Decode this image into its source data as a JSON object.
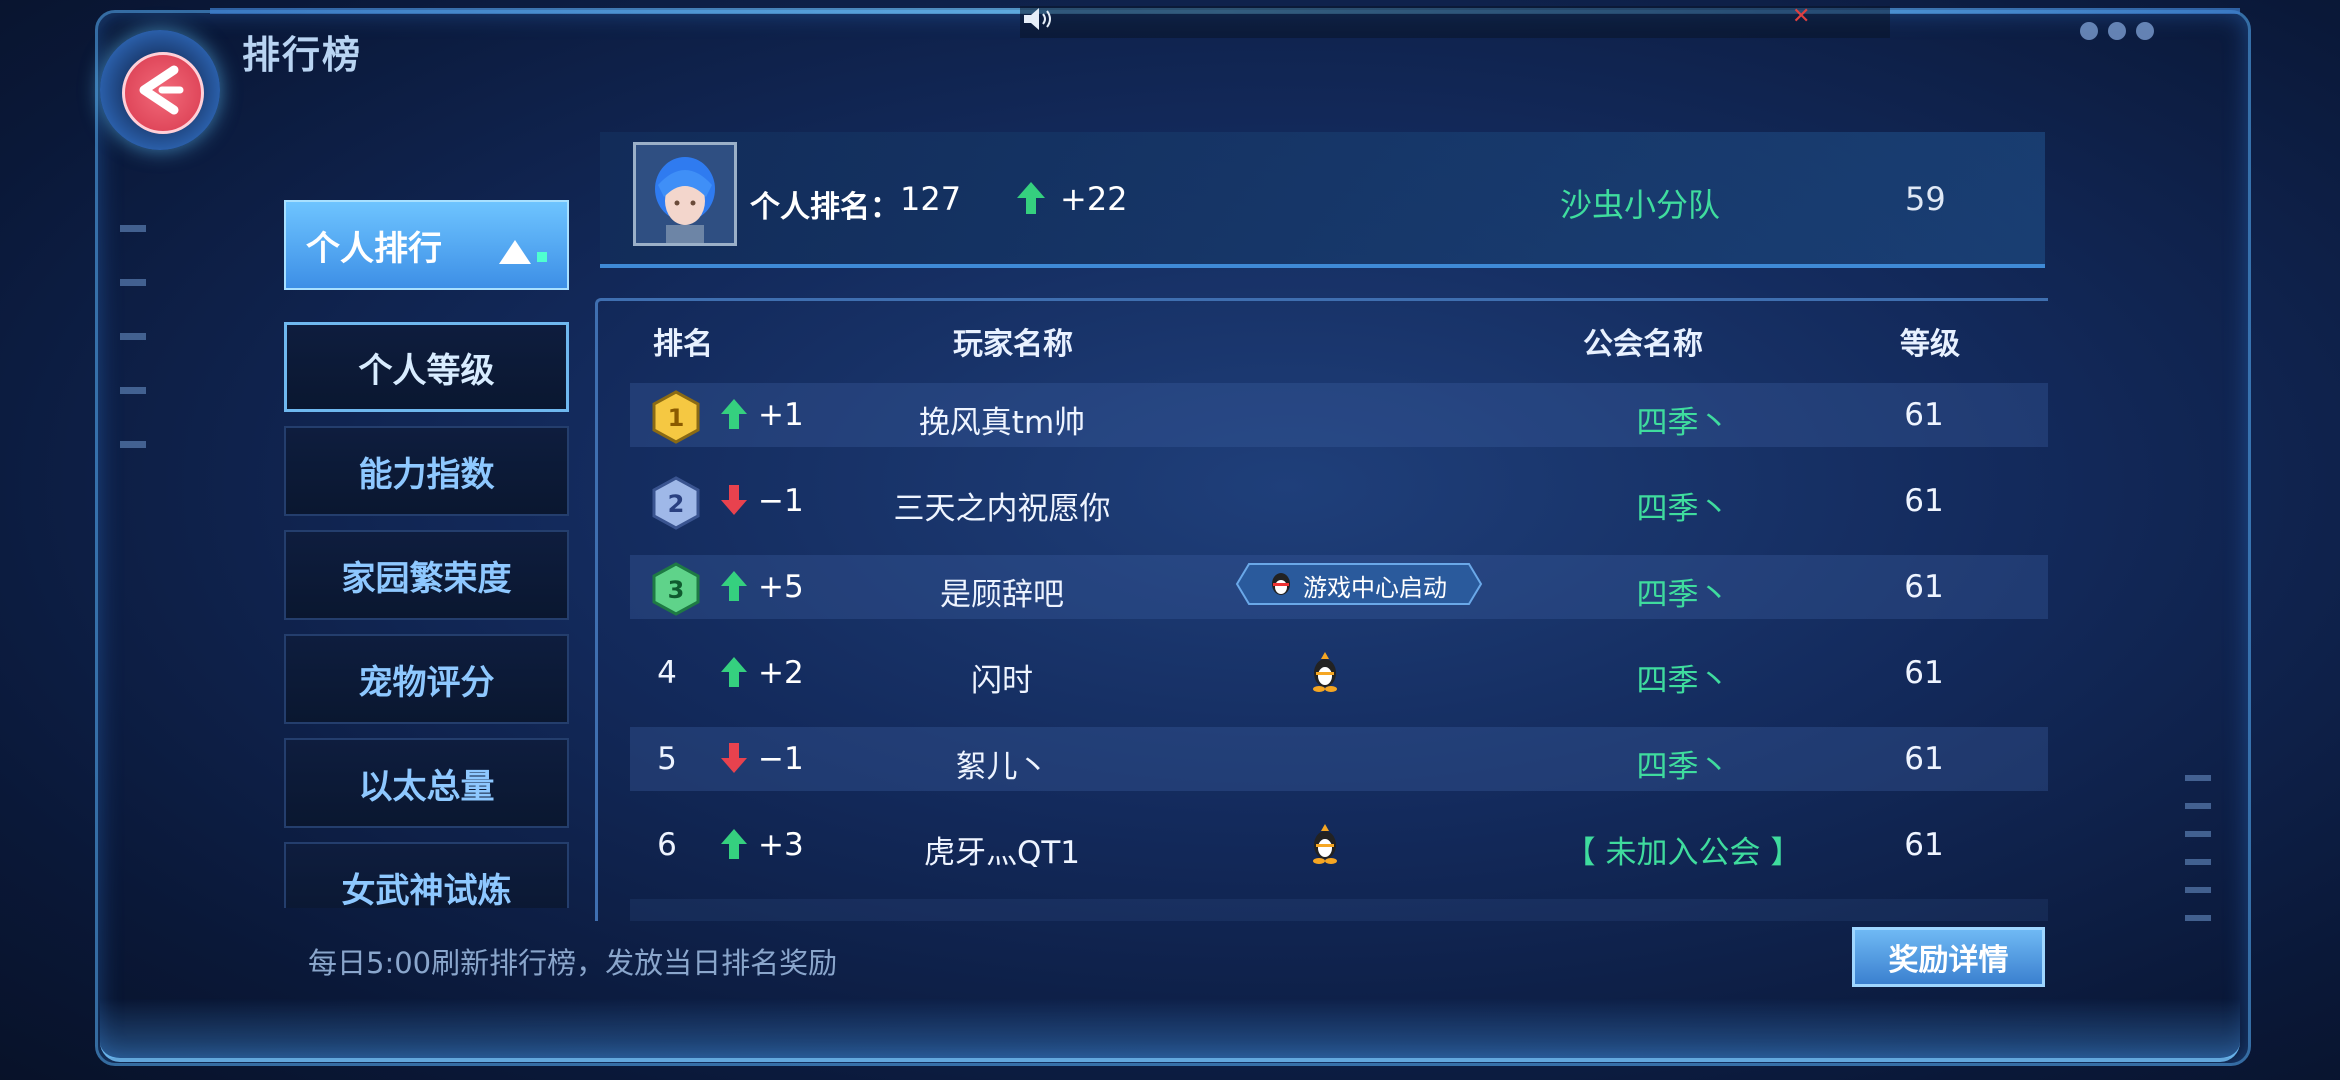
{
  "header": {
    "title": "排行榜"
  },
  "menu": {
    "items": [
      {
        "label": "个人排行"
      },
      {
        "label": "个人等级"
      },
      {
        "label": "能力指数"
      },
      {
        "label": "家园繁荣度"
      },
      {
        "label": "宠物评分"
      },
      {
        "label": "以太总量"
      },
      {
        "label": "女武神试炼"
      }
    ]
  },
  "me": {
    "label": "个人排名：",
    "rank": "127",
    "change": "+22",
    "change_dir": "up",
    "guild": "沙虫小分队",
    "level": "59"
  },
  "table": {
    "headers": {
      "rank": "排名",
      "player": "玩家名称",
      "guild": "公会名称",
      "level": "等级"
    },
    "rows": [
      {
        "rank": "1",
        "change": "+1",
        "dir": "up",
        "name": "挽风真tm帅",
        "tag": "",
        "guild": "四季丶",
        "level": "61"
      },
      {
        "rank": "2",
        "change": "−1",
        "dir": "down",
        "name": "三天之内祝愿你",
        "tag": "",
        "guild": "四季丶",
        "level": "61"
      },
      {
        "rank": "3",
        "change": "+5",
        "dir": "up",
        "name": "是顾辞吧",
        "tag": "游戏中心启动",
        "guild": "四季丶",
        "level": "61"
      },
      {
        "rank": "4",
        "change": "+2",
        "dir": "up",
        "name": "闪时",
        "tag": "",
        "guild": "四季丶",
        "level": "61"
      },
      {
        "rank": "5",
        "change": "−1",
        "dir": "down",
        "name": "絮儿丶",
        "tag": "",
        "guild": "四季丶",
        "level": "61"
      },
      {
        "rank": "6",
        "change": "+3",
        "dir": "up",
        "name": "虎牙灬QT1",
        "tag": "",
        "guild": "【 未加入公会 】",
        "level": "61"
      }
    ]
  },
  "footer": {
    "note": "每日5:00刷新排行榜，发放当日排名奖励",
    "reward_button": "奖励详情"
  },
  "colors": {
    "accent": "#3fdc9e",
    "up": "#35d07f",
    "down": "#e8424e",
    "gold": "#f5c842",
    "silver": "#9fb8e8",
    "bronze": "#5fd38a"
  }
}
